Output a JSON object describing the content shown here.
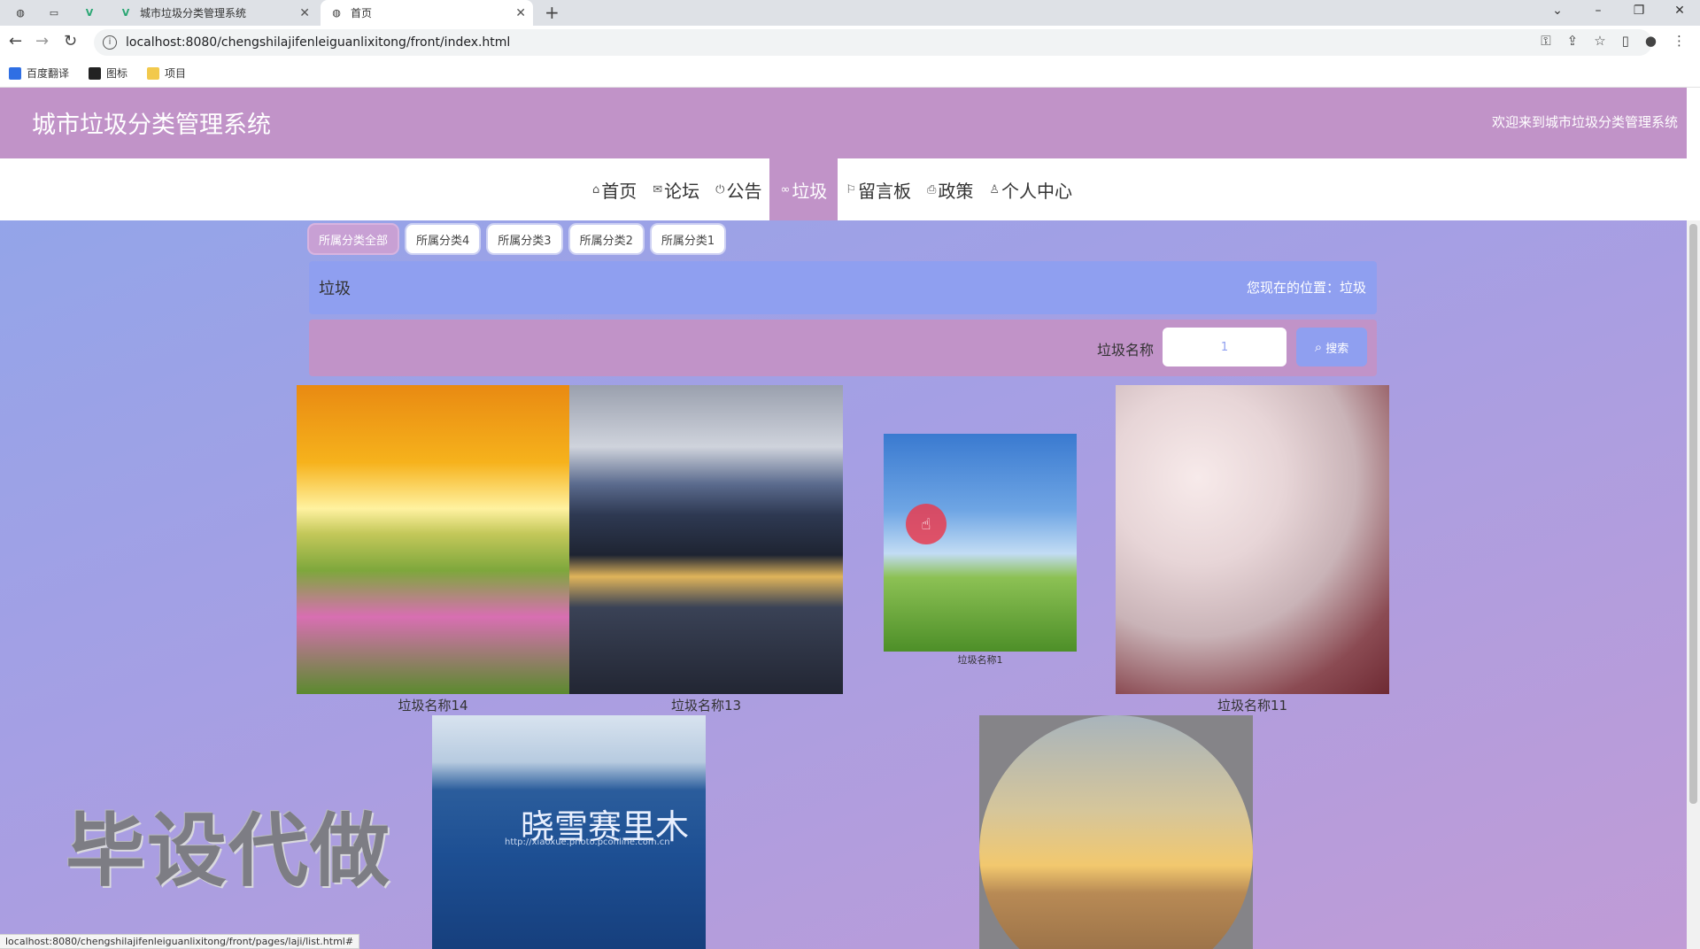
{
  "browser": {
    "tabs": [
      {
        "title": "",
        "icon": "globe-icon",
        "pinned": true
      },
      {
        "title": "",
        "icon": "blank-icon",
        "pinned": true
      },
      {
        "title": "",
        "icon": "vue-icon",
        "pinned": true
      },
      {
        "title": "城市垃圾分类管理系统",
        "icon": "vue-icon"
      },
      {
        "title": "首页",
        "icon": "globe-icon",
        "active": true
      }
    ],
    "url": "localhost:8080/chengshilajifenleiguanlixitong/front/index.html",
    "bookmarks": [
      "百度翻译",
      "图标",
      "项目"
    ],
    "status_url": "localhost:8080/chengshilajifenleiguanlixitong/front/pages/laji/list.html#"
  },
  "header": {
    "title": "城市垃圾分类管理系统",
    "welcome": "欢迎来到城市垃圾分类管理系统"
  },
  "menu": [
    {
      "label": "首页",
      "icon": "home-icon"
    },
    {
      "label": "论坛",
      "icon": "mail-icon"
    },
    {
      "label": "公告",
      "icon": "power-icon"
    },
    {
      "label": "垃圾",
      "icon": "link-icon",
      "active": true
    },
    {
      "label": "留言板",
      "icon": "flag-icon"
    },
    {
      "label": "政策",
      "icon": "print-icon"
    },
    {
      "label": "个人中心",
      "icon": "user-icon"
    }
  ],
  "filters": [
    "所属分类全部",
    "所属分类4",
    "所属分类3",
    "所属分类2",
    "所属分类1"
  ],
  "crumb": {
    "title": "垃圾",
    "location": "您现在的位置：垃圾"
  },
  "search": {
    "label": "垃圾名称",
    "value": "1",
    "button": "搜索"
  },
  "items": [
    {
      "name": "垃圾名称14"
    },
    {
      "name": "垃圾名称13"
    },
    {
      "name": "垃圾名称1"
    },
    {
      "name": "垃圾名称11"
    }
  ],
  "sea_logo": {
    "title": "晓雪赛里木",
    "sub": "http://xiaoxue.photo.pconline.com.cn"
  },
  "watermark": "毕设代做"
}
